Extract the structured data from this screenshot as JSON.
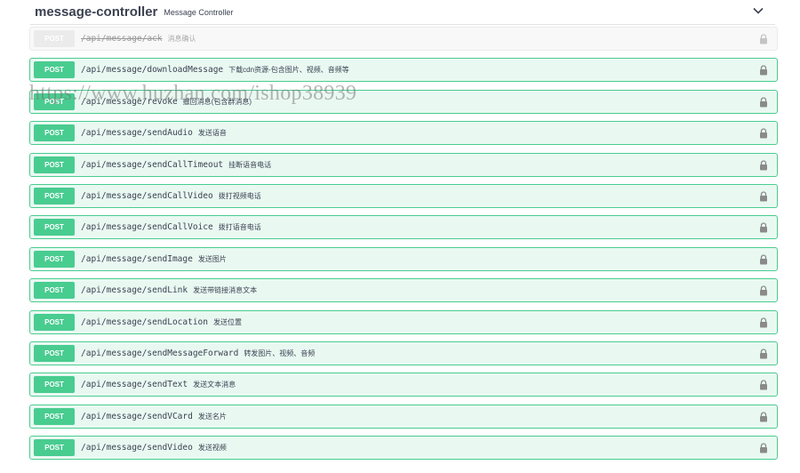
{
  "section": {
    "title": "message-controller",
    "description": "Message Controller"
  },
  "operations": [
    {
      "method": "POST",
      "path": "/api/message/ack",
      "summary": "消息确认",
      "deprecated": true
    },
    {
      "method": "POST",
      "path": "/api/message/downloadMessage",
      "summary": "下载cdn资源-包含图片、视频、音频等",
      "deprecated": false
    },
    {
      "method": "POST",
      "path": "/api/message/revoke",
      "summary": "撤回消息(包含群消息)",
      "deprecated": false
    },
    {
      "method": "POST",
      "path": "/api/message/sendAudio",
      "summary": "发送语音",
      "deprecated": false
    },
    {
      "method": "POST",
      "path": "/api/message/sendCallTimeout",
      "summary": "挂断语音电话",
      "deprecated": false
    },
    {
      "method": "POST",
      "path": "/api/message/sendCallVideo",
      "summary": "拨打视频电话",
      "deprecated": false
    },
    {
      "method": "POST",
      "path": "/api/message/sendCallVoice",
      "summary": "拨打语音电话",
      "deprecated": false
    },
    {
      "method": "POST",
      "path": "/api/message/sendImage",
      "summary": "发送图片",
      "deprecated": false
    },
    {
      "method": "POST",
      "path": "/api/message/sendLink",
      "summary": "发送带链接消息文本",
      "deprecated": false
    },
    {
      "method": "POST",
      "path": "/api/message/sendLocation",
      "summary": "发送位置",
      "deprecated": false
    },
    {
      "method": "POST",
      "path": "/api/message/sendMessageForward",
      "summary": "转发图片、视频、音频",
      "deprecated": false
    },
    {
      "method": "POST",
      "path": "/api/message/sendText",
      "summary": "发送文本消息",
      "deprecated": false
    },
    {
      "method": "POST",
      "path": "/api/message/sendVCard",
      "summary": "发送名片",
      "deprecated": false
    },
    {
      "method": "POST",
      "path": "/api/message/sendVideo",
      "summary": "发送视频",
      "deprecated": false
    }
  ],
  "watermark": "https://www.huzhan.com/ishop38939",
  "icons": {
    "collapse": "chevron-down-icon",
    "auth": "lock-icon"
  },
  "colors": {
    "post": "#49cc90",
    "deprecated": "#ebebeb",
    "text": "#3b4151"
  }
}
